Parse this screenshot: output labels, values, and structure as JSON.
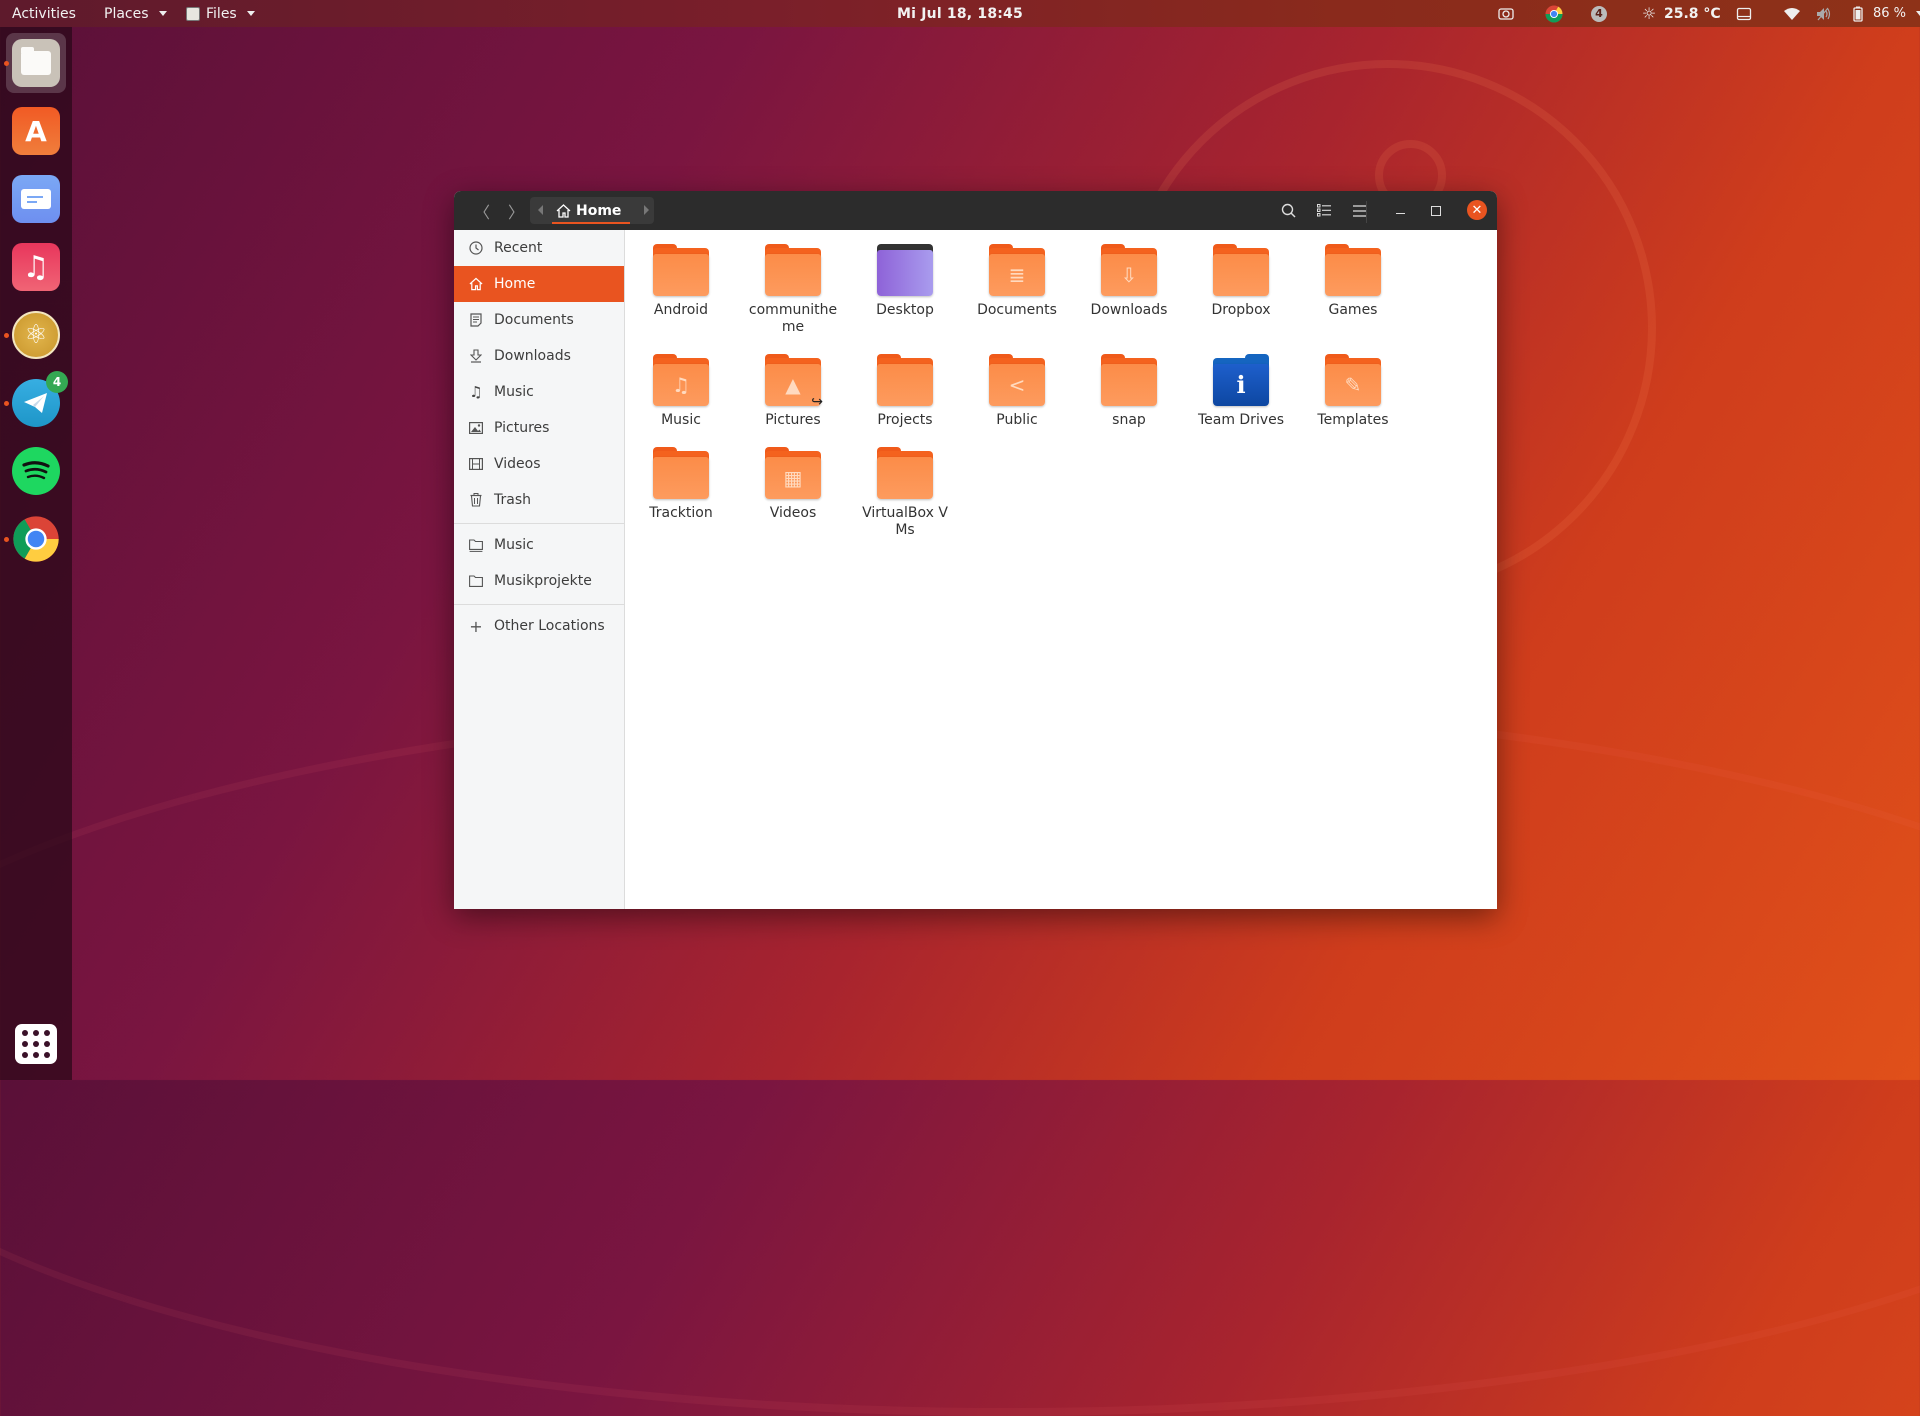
{
  "topbar": {
    "activities": "Activities",
    "places": "Places",
    "files": "Files",
    "clock": "Mi Jul 18, 18:45",
    "tray": {
      "screenshot_icon": "camera-icon",
      "chrome_icon": "chrome-icon",
      "notification_count": "4",
      "weather_icon": "sun-icon",
      "temperature": "25.8 °C",
      "display_icon": "display-icon",
      "wifi_icon": "wifi-icon",
      "volume_icon": "volume-muted-icon",
      "battery_icon": "battery-icon",
      "battery_percent": "86 %"
    }
  },
  "dock": {
    "items": [
      {
        "name": "Files",
        "icon": "files-icon",
        "running": true,
        "active": true
      },
      {
        "name": "Ubuntu Software",
        "icon": "software-icon",
        "running": false
      },
      {
        "name": "Mail",
        "icon": "mail-icon",
        "running": false
      },
      {
        "name": "Music",
        "icon": "music-icon",
        "running": false
      },
      {
        "name": "Atom",
        "icon": "atom-icon",
        "running": true
      },
      {
        "name": "Telegram",
        "icon": "telegram-icon",
        "running": true,
        "badge": "4"
      },
      {
        "name": "Spotify",
        "icon": "spotify-icon",
        "running": false
      },
      {
        "name": "Chrome",
        "icon": "chrome-icon",
        "running": true
      }
    ],
    "show_apps_icon": "app-grid-icon"
  },
  "window": {
    "path": {
      "current": "Home"
    },
    "sidebar": {
      "places": [
        {
          "label": "Recent",
          "icon": "clock-icon"
        },
        {
          "label": "Home",
          "icon": "home-icon",
          "selected": true
        },
        {
          "label": "Documents",
          "icon": "document-icon"
        },
        {
          "label": "Downloads",
          "icon": "download-icon"
        },
        {
          "label": "Music",
          "icon": "music-icon"
        },
        {
          "label": "Pictures",
          "icon": "picture-icon"
        },
        {
          "label": "Videos",
          "icon": "video-icon"
        },
        {
          "label": "Trash",
          "icon": "trash-icon"
        }
      ],
      "bookmarks": [
        {
          "label": "Music",
          "icon": "folder-icon"
        },
        {
          "label": "Musikprojekte",
          "icon": "folder-icon"
        }
      ],
      "other": {
        "label": "Other Locations",
        "icon": "plus-icon"
      }
    },
    "files": [
      {
        "name": "Android",
        "type": "folder"
      },
      {
        "name": "communitheme",
        "type": "folder"
      },
      {
        "name": "Desktop",
        "type": "desktop"
      },
      {
        "name": "Documents",
        "type": "folder",
        "emblem": "≣"
      },
      {
        "name": "Downloads",
        "type": "folder",
        "emblem": "⇩"
      },
      {
        "name": "Dropbox",
        "type": "folder"
      },
      {
        "name": "Games",
        "type": "folder"
      },
      {
        "name": "Music",
        "type": "folder",
        "emblem": "♫"
      },
      {
        "name": "Pictures",
        "type": "folder",
        "emblem": "▲",
        "symlink": true
      },
      {
        "name": "Projects",
        "type": "folder"
      },
      {
        "name": "Public",
        "type": "folder",
        "emblem": "<"
      },
      {
        "name": "snap",
        "type": "folder"
      },
      {
        "name": "Team Drives",
        "type": "teamdrive",
        "emblem": "ℹ"
      },
      {
        "name": "Templates",
        "type": "folder",
        "emblem": "✎"
      },
      {
        "name": "Tracktion",
        "type": "folder"
      },
      {
        "name": "Videos",
        "type": "folder",
        "emblem": "▦"
      },
      {
        "name": "VirtualBox VMs",
        "type": "folder"
      }
    ]
  },
  "colors": {
    "accent": "#e95420",
    "headerbar": "#2c2c2c",
    "sidebar": "#f5f6f7"
  }
}
